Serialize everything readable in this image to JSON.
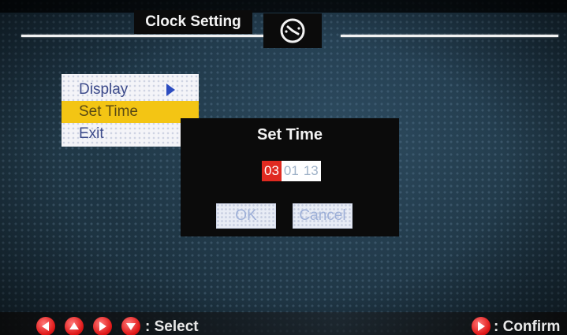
{
  "header": {
    "title": "Clock Setting",
    "icon": "clock-icon"
  },
  "menu": {
    "items": [
      {
        "label": "Display",
        "has_submenu": true,
        "selected": false
      },
      {
        "label": "Set Time",
        "has_submenu": false,
        "selected": true
      },
      {
        "label": "Exit",
        "has_submenu": false,
        "selected": false
      }
    ]
  },
  "dialog": {
    "title": "Set Time",
    "time": {
      "hour": "03",
      "minute": "01",
      "second": "13"
    },
    "ok_label": "OK",
    "cancel_label": "Cancel"
  },
  "footer": {
    "select_hint": ": Select",
    "confirm_hint": ": Confirm",
    "nav_icons": [
      "arrow-left-icon",
      "arrow-up-icon",
      "arrow-right-icon",
      "arrow-down-icon"
    ],
    "confirm_icon": "play-right-icon"
  },
  "colors": {
    "selected_item": "#f3c514",
    "active_segment": "#e02a20",
    "nav_button": "#e01818"
  }
}
